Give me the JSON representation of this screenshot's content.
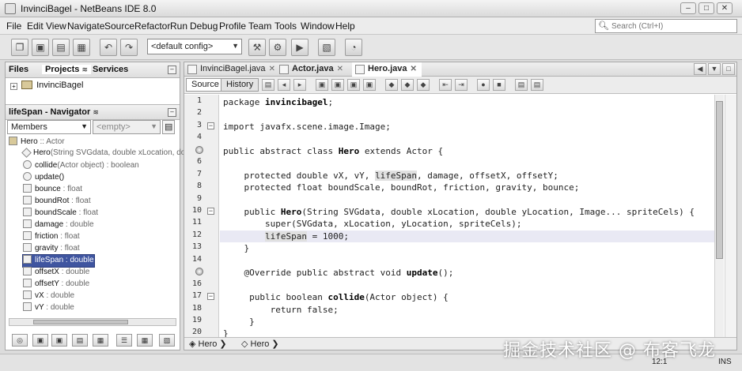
{
  "window": {
    "title": "InvinciBagel - NetBeans IDE 8.0",
    "controls": [
      "–",
      "□",
      "✕"
    ]
  },
  "menubar": {
    "items": [
      "File",
      "Edit",
      "View",
      "Navigate",
      "Source",
      "Refactor",
      "Run",
      "Debug",
      "Profile",
      "Team",
      "Tools",
      "Window",
      "Help"
    ],
    "search_placeholder": "Search (Ctrl+I)"
  },
  "toolbar": {
    "config_value": "<default config>"
  },
  "projects_panel": {
    "tabs": [
      "Files",
      "Projects",
      "Services"
    ],
    "tab_close": "≋",
    "active_tab": "Projects",
    "project": "InvinciBagel"
  },
  "navigator": {
    "title": "lifeSpan - Navigator",
    "title_close": "≋",
    "filter_value": "Members",
    "filter_empty": "<empty>",
    "root": {
      "name": "Hero",
      "type": " :: Actor"
    },
    "members": [
      {
        "name": "Hero",
        "type": "(String SVGdata, double xLocation, dou"
      },
      {
        "name": "collide",
        "type": "(Actor object) : boolean"
      },
      {
        "name": "update()",
        "type": ""
      },
      {
        "name": "bounce",
        "type": " : float"
      },
      {
        "name": "boundRot",
        "type": " : float"
      },
      {
        "name": "boundScale",
        "type": " : float"
      },
      {
        "name": "damage",
        "type": " : double"
      },
      {
        "name": "friction",
        "type": " : float"
      },
      {
        "name": "gravity",
        "type": " : float"
      },
      {
        "name": "lifeSpan",
        "type": " : double",
        "selected": true
      },
      {
        "name": "offsetX",
        "type": " : double"
      },
      {
        "name": "offsetY",
        "type": " : double"
      },
      {
        "name": "vX",
        "type": " : double"
      },
      {
        "name": "vY",
        "type": " : double"
      }
    ]
  },
  "editor": {
    "tabs": [
      {
        "label": "InvinciBagel.java",
        "active": false
      },
      {
        "label": "Actor.java",
        "active": false
      },
      {
        "label": "Hero.java",
        "active": true
      }
    ],
    "tab_close": "✕",
    "source_label": "Source",
    "history_label": "History",
    "current_line": 12,
    "lines": [
      {
        "n": "1",
        "text": "package invincibagel;"
      },
      {
        "n": "2",
        "text": ""
      },
      {
        "n": "3",
        "text": "import javafx.scene.image.Image;",
        "fold": "−"
      },
      {
        "n": "4",
        "text": ""
      },
      {
        "n": "",
        "text": "public abstract class Hero extends Actor {",
        "override": true
      },
      {
        "n": "6",
        "text": ""
      },
      {
        "n": "7",
        "text": "    protected double vX, vY, lifeSpan, damage, offsetX, offsetY;"
      },
      {
        "n": "8",
        "text": "    protected float boundScale, boundRot, friction, gravity, bounce;"
      },
      {
        "n": "9",
        "text": ""
      },
      {
        "n": "10",
        "text": "    public Hero(String SVGdata, double xLocation, double yLocation, Image... spriteCels) {",
        "fold": "−"
      },
      {
        "n": "11",
        "text": "        super(SVGdata, xLocation, yLocation, spriteCels);"
      },
      {
        "n": "12",
        "text": "        lifeSpan = 1000;"
      },
      {
        "n": "13",
        "text": "    }",
        "fold_end": true
      },
      {
        "n": "14",
        "text": ""
      },
      {
        "n": "",
        "text": "    @Override public abstract void update();",
        "override": true
      },
      {
        "n": "16",
        "text": ""
      },
      {
        "n": "17",
        "text": "     public boolean collide(Actor object) {",
        "fold": "−"
      },
      {
        "n": "18",
        "text": "         return false;"
      },
      {
        "n": "19",
        "text": "     }",
        "fold_end": true
      },
      {
        "n": "20",
        "text": "}"
      }
    ],
    "breadcrumbs": [
      "Hero",
      "Hero"
    ]
  },
  "statusbar": {
    "position": "12:1",
    "insert_mode": "INS"
  },
  "watermark": "掘金技术社区 @ 布客飞龙"
}
